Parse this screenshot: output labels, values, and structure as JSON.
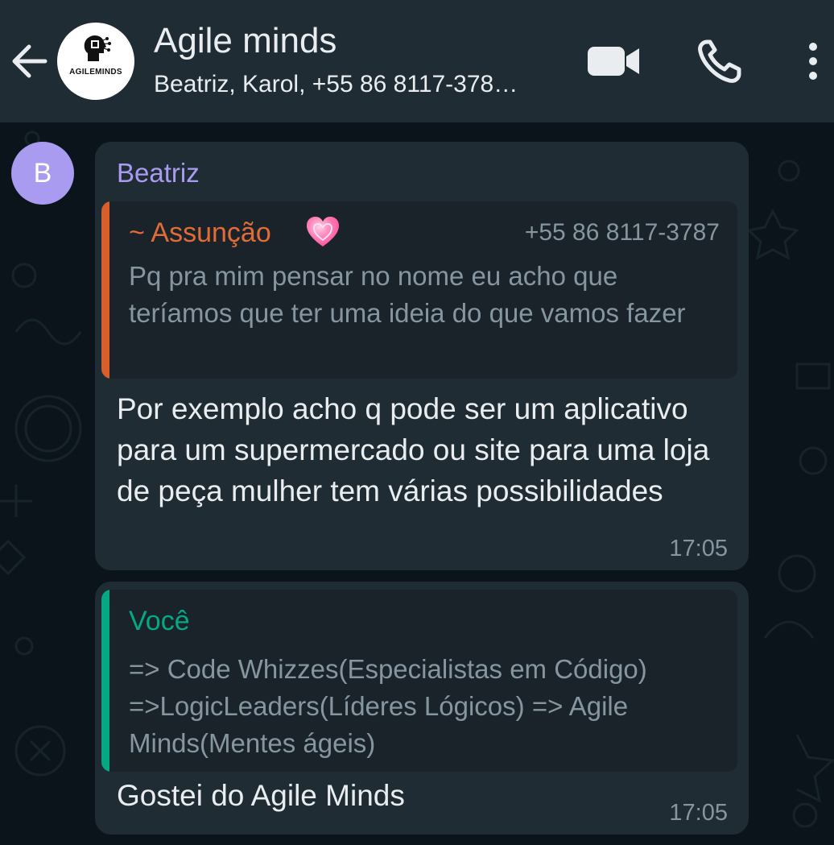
{
  "header": {
    "title": "Agile minds",
    "subtitle": "Beatriz, Karol, +55 86 8117-378…",
    "avatar_logo_text": "AGILEMINDS"
  },
  "messages": [
    {
      "avatar_initial": "B",
      "sender": "Beatriz",
      "quote": {
        "author": "~ Assunção",
        "phone": "+55 86 8117-3787",
        "text": "Pq pra mim pensar no nome eu acho que teríamos que ter uma ideia do que vamos fazer"
      },
      "text": "Por exemplo acho q pode ser um aplicativo para um supermercado ou site para uma loja de peça mulher tem várias possibilidades",
      "time": "17:05"
    },
    {
      "quote": {
        "author": "Você",
        "text": "=> Code Whizzes(Especialistas em Código)  =>LogicLeaders(Líderes Lógicos) => Agile Minds(Mentes ágeis)"
      },
      "text": "Gostei do Agile Minds",
      "time": "17:05"
    }
  ],
  "colors": {
    "header_bg": "#1f2c34",
    "chat_bg": "#0b141a",
    "bubble_bg": "#202c33",
    "sender_name": "#a99cf0",
    "quote_author_other": "#e26b36",
    "quote_author_self": "#06a884"
  },
  "icons": [
    "back-arrow-icon",
    "video-call-icon",
    "phone-icon",
    "more-vert-icon",
    "heart-emoji-icon",
    "brain-chip-logo-icon"
  ]
}
